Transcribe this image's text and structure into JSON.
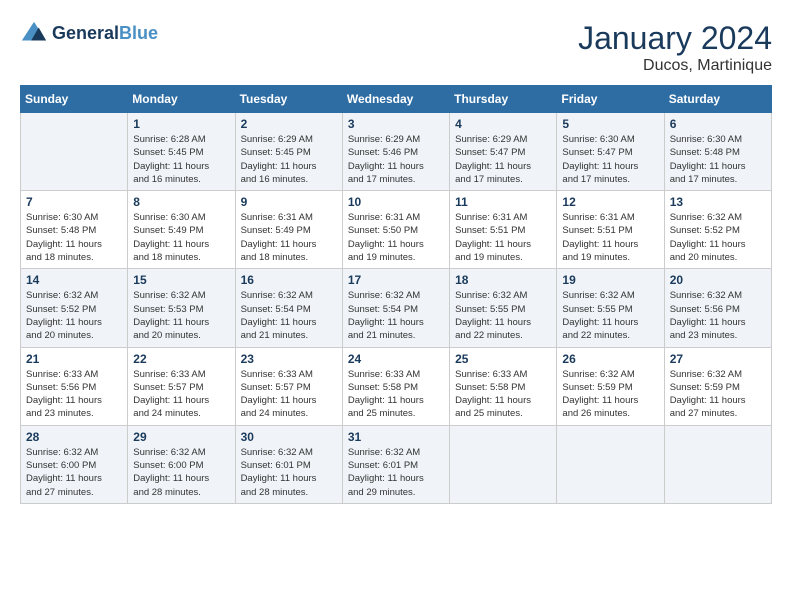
{
  "header": {
    "logo_line1": "General",
    "logo_line2": "Blue",
    "month_title": "January 2024",
    "location": "Ducos, Martinique"
  },
  "days_of_week": [
    "Sunday",
    "Monday",
    "Tuesday",
    "Wednesday",
    "Thursday",
    "Friday",
    "Saturday"
  ],
  "weeks": [
    [
      {
        "day": "",
        "info": ""
      },
      {
        "day": "1",
        "info": "Sunrise: 6:28 AM\nSunset: 5:45 PM\nDaylight: 11 hours\nand 16 minutes."
      },
      {
        "day": "2",
        "info": "Sunrise: 6:29 AM\nSunset: 5:45 PM\nDaylight: 11 hours\nand 16 minutes."
      },
      {
        "day": "3",
        "info": "Sunrise: 6:29 AM\nSunset: 5:46 PM\nDaylight: 11 hours\nand 17 minutes."
      },
      {
        "day": "4",
        "info": "Sunrise: 6:29 AM\nSunset: 5:47 PM\nDaylight: 11 hours\nand 17 minutes."
      },
      {
        "day": "5",
        "info": "Sunrise: 6:30 AM\nSunset: 5:47 PM\nDaylight: 11 hours\nand 17 minutes."
      },
      {
        "day": "6",
        "info": "Sunrise: 6:30 AM\nSunset: 5:48 PM\nDaylight: 11 hours\nand 17 minutes."
      }
    ],
    [
      {
        "day": "7",
        "info": "Sunrise: 6:30 AM\nSunset: 5:48 PM\nDaylight: 11 hours\nand 18 minutes."
      },
      {
        "day": "8",
        "info": "Sunrise: 6:30 AM\nSunset: 5:49 PM\nDaylight: 11 hours\nand 18 minutes."
      },
      {
        "day": "9",
        "info": "Sunrise: 6:31 AM\nSunset: 5:49 PM\nDaylight: 11 hours\nand 18 minutes."
      },
      {
        "day": "10",
        "info": "Sunrise: 6:31 AM\nSunset: 5:50 PM\nDaylight: 11 hours\nand 19 minutes."
      },
      {
        "day": "11",
        "info": "Sunrise: 6:31 AM\nSunset: 5:51 PM\nDaylight: 11 hours\nand 19 minutes."
      },
      {
        "day": "12",
        "info": "Sunrise: 6:31 AM\nSunset: 5:51 PM\nDaylight: 11 hours\nand 19 minutes."
      },
      {
        "day": "13",
        "info": "Sunrise: 6:32 AM\nSunset: 5:52 PM\nDaylight: 11 hours\nand 20 minutes."
      }
    ],
    [
      {
        "day": "14",
        "info": "Sunrise: 6:32 AM\nSunset: 5:52 PM\nDaylight: 11 hours\nand 20 minutes."
      },
      {
        "day": "15",
        "info": "Sunrise: 6:32 AM\nSunset: 5:53 PM\nDaylight: 11 hours\nand 20 minutes."
      },
      {
        "day": "16",
        "info": "Sunrise: 6:32 AM\nSunset: 5:54 PM\nDaylight: 11 hours\nand 21 minutes."
      },
      {
        "day": "17",
        "info": "Sunrise: 6:32 AM\nSunset: 5:54 PM\nDaylight: 11 hours\nand 21 minutes."
      },
      {
        "day": "18",
        "info": "Sunrise: 6:32 AM\nSunset: 5:55 PM\nDaylight: 11 hours\nand 22 minutes."
      },
      {
        "day": "19",
        "info": "Sunrise: 6:32 AM\nSunset: 5:55 PM\nDaylight: 11 hours\nand 22 minutes."
      },
      {
        "day": "20",
        "info": "Sunrise: 6:32 AM\nSunset: 5:56 PM\nDaylight: 11 hours\nand 23 minutes."
      }
    ],
    [
      {
        "day": "21",
        "info": "Sunrise: 6:33 AM\nSunset: 5:56 PM\nDaylight: 11 hours\nand 23 minutes."
      },
      {
        "day": "22",
        "info": "Sunrise: 6:33 AM\nSunset: 5:57 PM\nDaylight: 11 hours\nand 24 minutes."
      },
      {
        "day": "23",
        "info": "Sunrise: 6:33 AM\nSunset: 5:57 PM\nDaylight: 11 hours\nand 24 minutes."
      },
      {
        "day": "24",
        "info": "Sunrise: 6:33 AM\nSunset: 5:58 PM\nDaylight: 11 hours\nand 25 minutes."
      },
      {
        "day": "25",
        "info": "Sunrise: 6:33 AM\nSunset: 5:58 PM\nDaylight: 11 hours\nand 25 minutes."
      },
      {
        "day": "26",
        "info": "Sunrise: 6:32 AM\nSunset: 5:59 PM\nDaylight: 11 hours\nand 26 minutes."
      },
      {
        "day": "27",
        "info": "Sunrise: 6:32 AM\nSunset: 5:59 PM\nDaylight: 11 hours\nand 27 minutes."
      }
    ],
    [
      {
        "day": "28",
        "info": "Sunrise: 6:32 AM\nSunset: 6:00 PM\nDaylight: 11 hours\nand 27 minutes."
      },
      {
        "day": "29",
        "info": "Sunrise: 6:32 AM\nSunset: 6:00 PM\nDaylight: 11 hours\nand 28 minutes."
      },
      {
        "day": "30",
        "info": "Sunrise: 6:32 AM\nSunset: 6:01 PM\nDaylight: 11 hours\nand 28 minutes."
      },
      {
        "day": "31",
        "info": "Sunrise: 6:32 AM\nSunset: 6:01 PM\nDaylight: 11 hours\nand 29 minutes."
      },
      {
        "day": "",
        "info": ""
      },
      {
        "day": "",
        "info": ""
      },
      {
        "day": "",
        "info": ""
      }
    ]
  ]
}
